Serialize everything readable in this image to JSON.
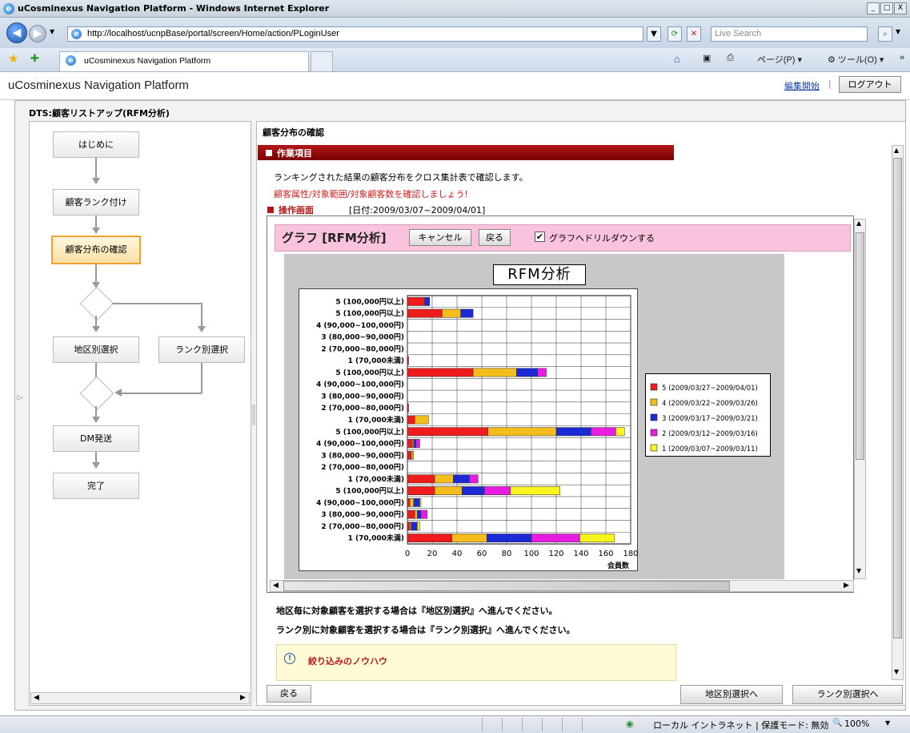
{
  "window": {
    "title": "uCosminexus Navigation Platform - Windows Internet Explorer",
    "controls": [
      "_",
      "□",
      "X"
    ]
  },
  "address": {
    "url": "http://localhost/ucnpBase/portal/screen/Home/action/PLoginUser",
    "search_placeholder": "Live Search"
  },
  "tabs": [
    {
      "label": "uCosminexus Navigation Platform"
    }
  ],
  "commands": {
    "page": "ページ(P)",
    "tools": "ツール(O)"
  },
  "portal": {
    "title": "uCosminexus Navigation Platform",
    "edit_link": "編集開始",
    "separator": "|",
    "logout": "ログアウト"
  },
  "process_title": "DTS:顧客リストアップ(RFM分析)",
  "flow": {
    "start": "はじめに",
    "rank": "顧客ランク付け",
    "dist": "顧客分布の確認",
    "region": "地区別選択",
    "rank_select": "ランク別選択",
    "dm": "DM発送",
    "done": "完了"
  },
  "content": {
    "section_title": "顧客分布の確認",
    "work_item": "作業項目",
    "desc1": "ランキングされた結果の顧客分布をクロス集計表で確認します。",
    "desc2": "顧客属性/対象範囲/対象顧客数を確認しましょう!",
    "op_label": "操作画面",
    "op_date": "[日付:2009/03/07~2009/04/01]",
    "note1": "地区毎に対象顧客を選択する場合は『地区別選択』へ進んでください。",
    "note2": "ランク別に対象顧客を選択する場合は『ランク別選択』へ進んでください。",
    "knowhow": "絞り込みのノウハウ",
    "knowhow_icon": "info-icon"
  },
  "graph_panel": {
    "title": "グラフ [RFM分析]",
    "cancel": "キャンセル",
    "back": "戻る",
    "drill_label": "グラフへドリルダウンする",
    "drill_checked": true
  },
  "bottom_nav": {
    "back": "戻る",
    "to_region": "地区別選択へ",
    "to_rank": "ランク別選択へ"
  },
  "statusbar": {
    "zone": "ローカル イントラネット | 保護モード: 無効",
    "zoom": "100%"
  },
  "chart_data": {
    "type": "bar",
    "orientation": "horizontal",
    "stacked": true,
    "title": "RFM分析",
    "xlabel": "会員数",
    "ylabel": "",
    "xlim": [
      0,
      180
    ],
    "xticks": [
      0,
      20,
      40,
      60,
      80,
      100,
      120,
      140,
      160,
      180
    ],
    "grid": true,
    "legend_position": "right",
    "categories": [
      "5 (100,000円以上)",
      "5 (100,000円以上)",
      "4 (90,000~100,000円)",
      "3 (80,000~90,000円)",
      "2 (70,000~80,000円)",
      "1 (70,000未満)",
      "5 (100,000円以上)",
      "4 (90,000~100,000円)",
      "3 (80,000~90,000円)",
      "2 (70,000~80,000円)",
      "1 (70,000未満)",
      "5 (100,000円以上)",
      "4 (90,000~100,000円)",
      "3 (80,000~90,000円)",
      "2 (70,000~80,000円)",
      "1 (70,000未満)",
      "5 (100,000円以上)",
      "4 (90,000~100,000円)",
      "3 (80,000~90,000円)",
      "2 (70,000~80,000円)",
      "1 (70,000未満)"
    ],
    "series": [
      {
        "name": "5 (2009/03/27~2009/04/01)",
        "color": "#ee1c1c",
        "values": [
          14,
          28,
          0,
          0,
          0,
          1,
          53,
          0,
          0,
          1,
          6,
          65,
          4,
          3,
          0,
          22,
          22,
          2,
          6,
          2,
          36
        ]
      },
      {
        "name": "4 (2009/03/22~2009/03/26)",
        "color": "#f5bd1c",
        "values": [
          0,
          15,
          0,
          0,
          0,
          0,
          35,
          0,
          0,
          0,
          11,
          55,
          1,
          1,
          0,
          15,
          22,
          3,
          2,
          1,
          28
        ]
      },
      {
        "name": "3 (2009/03/17~2009/03/21)",
        "color": "#1c2ad6",
        "values": [
          4,
          10,
          0,
          0,
          0,
          0,
          17,
          0,
          0,
          0,
          0,
          28,
          2,
          0,
          0,
          13,
          18,
          5,
          3,
          5,
          36
        ]
      },
      {
        "name": "2 (2009/03/12~2009/03/16)",
        "color": "#e81ce0",
        "values": [
          0,
          0,
          0,
          0,
          0,
          0,
          7,
          0,
          0,
          0,
          0,
          20,
          3,
          0,
          0,
          7,
          21,
          0,
          5,
          0,
          39
        ]
      },
      {
        "name": "1 (2009/03/07~2009/03/11)",
        "color": "#f9f31e",
        "values": [
          0,
          0,
          0,
          0,
          0,
          0,
          0,
          0,
          0,
          0,
          0,
          7,
          0,
          1,
          0,
          0,
          40,
          1,
          0,
          2,
          28
        ]
      }
    ]
  }
}
